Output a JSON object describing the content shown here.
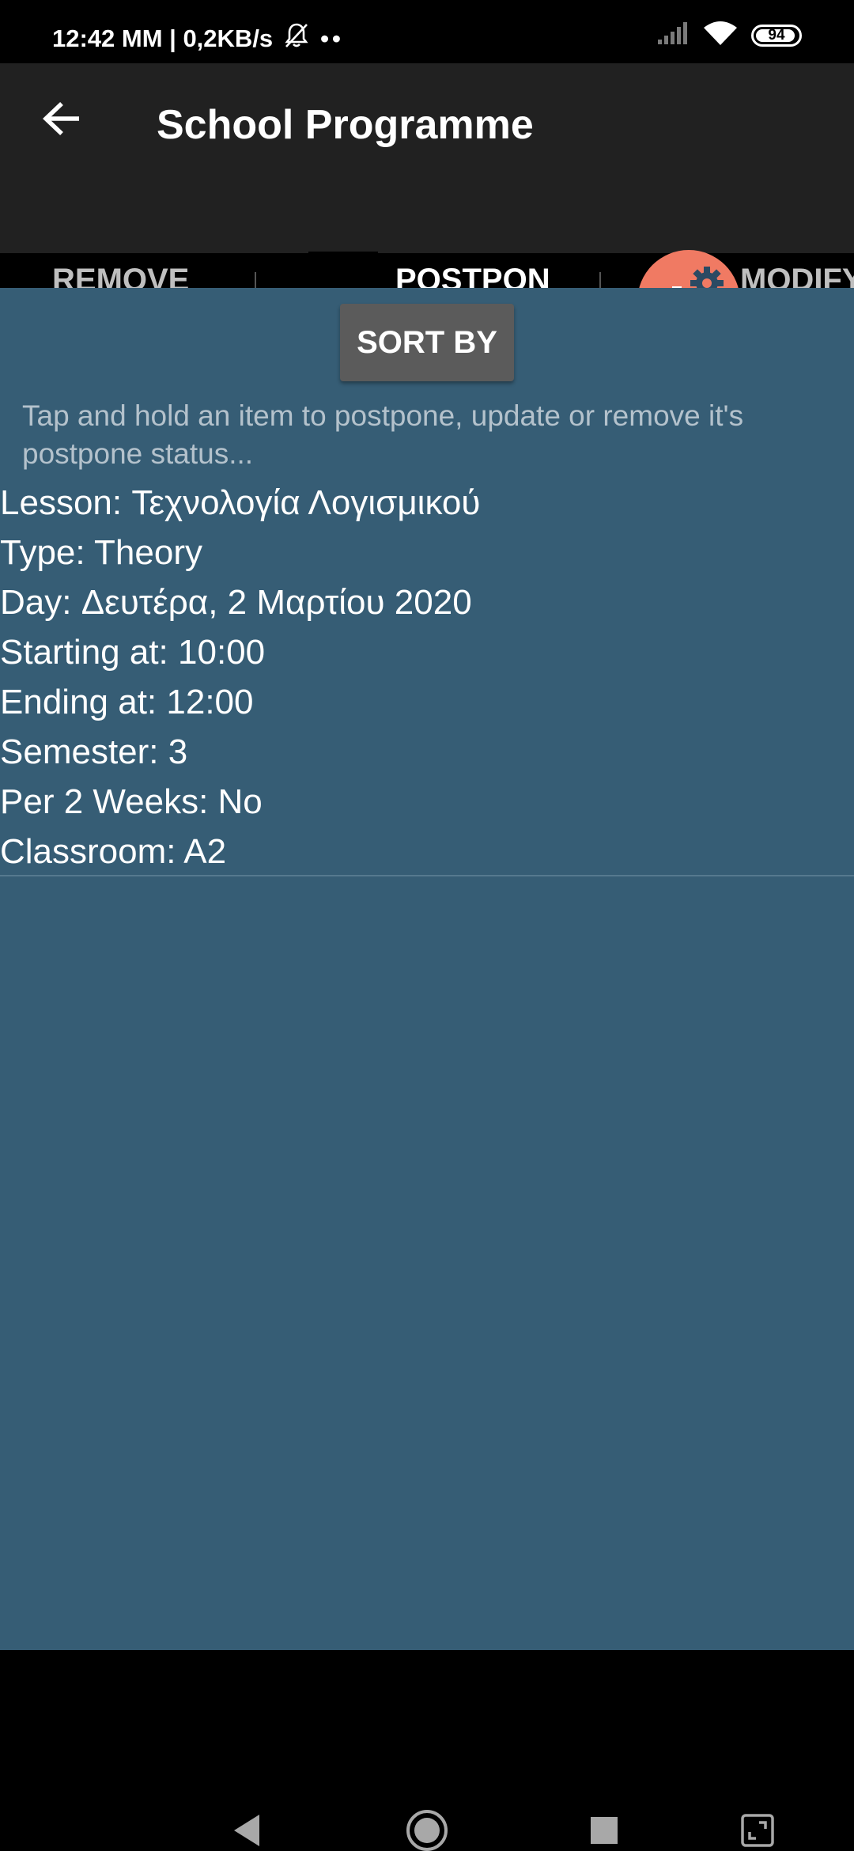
{
  "status_bar": {
    "time": "12:42 MM | 0,2KB/s",
    "extra_dots": "••",
    "battery_level": "94",
    "battery_fraction": 0.94
  },
  "app_bar": {
    "title": "School Programme"
  },
  "tabs": [
    {
      "label": "REMOVE\nLESSONS",
      "icon": "recycle-bin-icon",
      "selected": false
    },
    {
      "label": "POSTPON\nE LESSON",
      "icon": "hourglass-icon",
      "selected": true
    },
    {
      "label": "MODIFY\nLESSONS",
      "icon": "gears-icon",
      "selected": false
    }
  ],
  "sort_button": {
    "label": "SORT BY"
  },
  "hint": "Tap and hold an item to postpone, update or remove it's postpone status...",
  "lesson_item": {
    "lesson": "Lesson: Τεχνολογία Λογισμικού",
    "type": "Type: Theory",
    "day": "Day: Δευτέρα, 2 Μαρτίου 2020",
    "starting_at": "Starting at: 10:00",
    "ending_at": "Ending at: 12:00",
    "semester": "Semester: 3",
    "per_2_weeks": "Per 2 Weeks: No",
    "classroom": "Classroom: A2"
  },
  "colors": {
    "app_bar": "#212121",
    "content_background": "#365d75",
    "tab_indicator": "#7ecbd0",
    "gear_badge": "#f07a63",
    "sort_button": "#5b5b5b"
  }
}
